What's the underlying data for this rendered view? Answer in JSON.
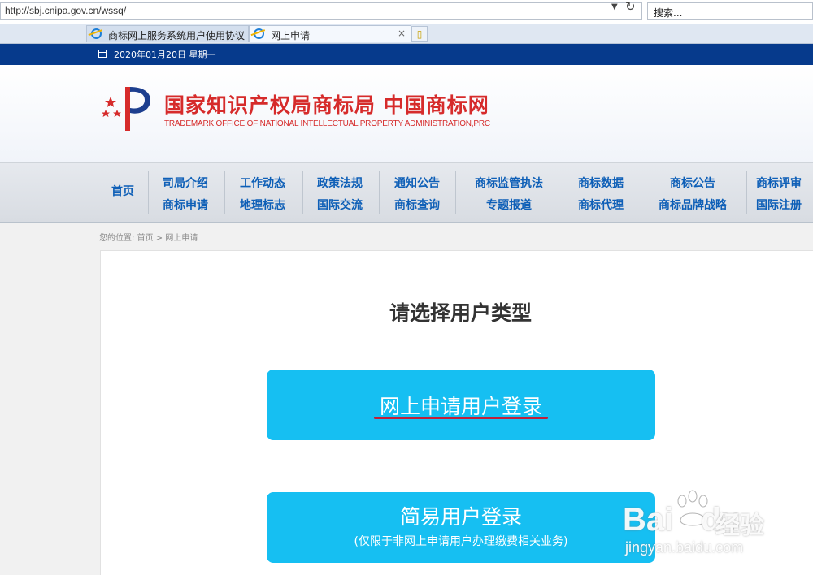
{
  "browser": {
    "url": "http://sbj.cnipa.gov.cn/wssq/",
    "search_placeholder": "搜索...",
    "tabs": [
      {
        "label": "商标网上服务系统用户使用协议",
        "active": false
      },
      {
        "label": "网上申请",
        "active": true
      }
    ],
    "close_glyph": "×"
  },
  "topbar": {
    "date": "2020年01月20日 星期一"
  },
  "header": {
    "title_cn": "国家知识产权局商标局 中国商标网",
    "title_en": "TRADEMARK OFFICE OF NATIONAL INTELLECTUAL PROPERTY ADMINISTRATION,PRC",
    "brand_color": "#d62b2b"
  },
  "nav": {
    "home": "首页",
    "columns": [
      {
        "top": "司局介绍",
        "bottom": "商标申请"
      },
      {
        "top": "工作动态",
        "bottom": "地理标志"
      },
      {
        "top": "政策法规",
        "bottom": "国际交流"
      },
      {
        "top": "通知公告",
        "bottom": "商标查询"
      },
      {
        "top": "商标监管执法",
        "bottom": "专题报道"
      },
      {
        "top": "商标数据",
        "bottom": "商标代理"
      },
      {
        "top": "商标公告",
        "bottom": "商标品牌战略"
      },
      {
        "top": "商标评审",
        "bottom": "国际注册"
      }
    ]
  },
  "breadcrumb": {
    "prefix": "您的位置:",
    "home": "首页",
    "sep": ">",
    "current": "网上申请"
  },
  "main": {
    "title": "请选择用户类型",
    "login_online": "网上申请用户登录",
    "login_simple": "简易用户登录",
    "login_simple_note": "(仅限于非网上申请用户办理缴费相关业务)",
    "button_color": "#16bff2"
  },
  "watermark": {
    "brand": "Bai",
    "brand2": "du",
    "jingyan": "经验",
    "url": "jingyan.baidu.com"
  }
}
